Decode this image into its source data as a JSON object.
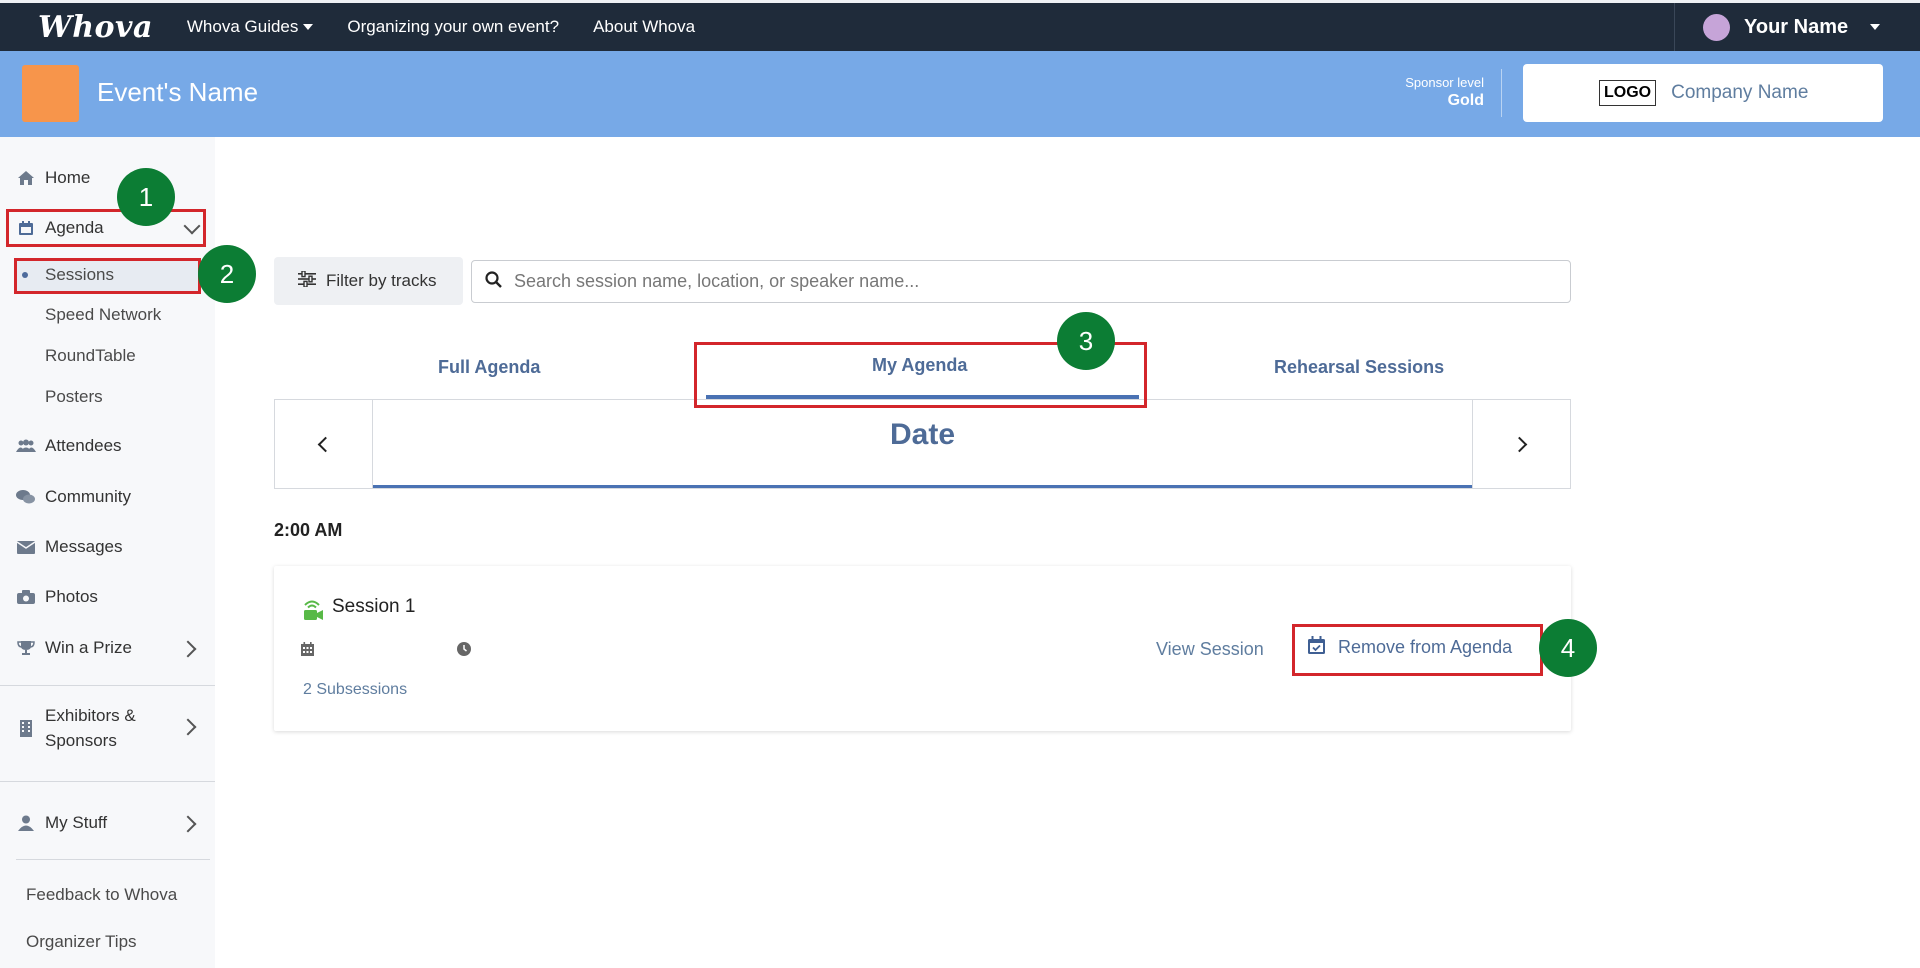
{
  "topnav": {
    "brand": "Whova",
    "items": [
      {
        "label": "Whova Guides",
        "dropdown": true
      },
      {
        "label": "Organizing your own event?",
        "dropdown": false
      },
      {
        "label": "About Whova",
        "dropdown": false
      }
    ],
    "user_name": "Your Name"
  },
  "event": {
    "name": "Event's Name",
    "sponsor_level_label": "Sponsor level",
    "sponsor_level_value": "Gold",
    "logo_text": "LOGO",
    "company_name": "Company Name"
  },
  "sidebar": {
    "home": "Home",
    "agenda": "Agenda",
    "agenda_sub": [
      "Sessions",
      "Speed Network",
      "RoundTable",
      "Posters"
    ],
    "attendees": "Attendees",
    "community": "Community",
    "messages": "Messages",
    "photos": "Photos",
    "win_prize": "Win a Prize",
    "exhibitors_line1": "Exhibitors &",
    "exhibitors_line2": "Sponsors",
    "my_stuff": "My Stuff",
    "feedback": "Feedback to Whova",
    "organizer_tips": "Organizer Tips"
  },
  "annotations": [
    "1",
    "2",
    "3",
    "4"
  ],
  "toolbar": {
    "filter_label": "Filter by tracks",
    "search_placeholder": "Search session name, location, or speaker name..."
  },
  "tabs": {
    "full": "Full Agenda",
    "my": "My Agenda",
    "rehearsal": "Rehearsal Sessions",
    "active": "My Agenda"
  },
  "date": {
    "label": "Date"
  },
  "schedule": {
    "time": "2:00 AM",
    "session": {
      "title": "Session 1",
      "subsessions": "2 Subsessions",
      "view_label": "View Session",
      "remove_label": "Remove from Agenda"
    }
  },
  "colors": {
    "topbar": "#1f2b3a",
    "eventbar": "#77a9e7",
    "accent": "#4a72b3",
    "annotation_red": "#d3262b",
    "annotation_green": "#0c7d34"
  }
}
